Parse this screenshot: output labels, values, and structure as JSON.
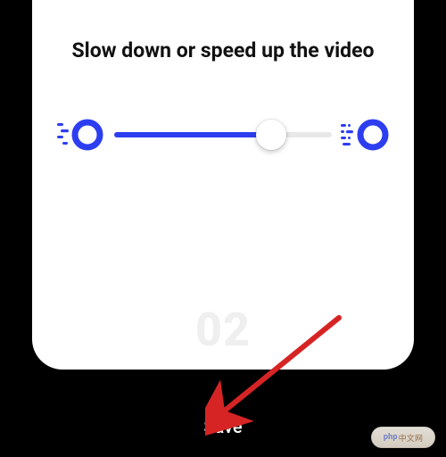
{
  "title": "Slow down or speed up the video",
  "slider": {
    "value_percent": 72,
    "min_label": "slow",
    "max_label": "fast"
  },
  "page_number": "02",
  "save_label": "Save",
  "colors": {
    "accent": "#2d3ef0",
    "arrow": "#d62424"
  },
  "icons": {
    "slow": "motion-slow-icon",
    "fast": "motion-fast-icon"
  },
  "watermark_text_prefix": "php",
  "watermark_text_suffix": "中文网"
}
